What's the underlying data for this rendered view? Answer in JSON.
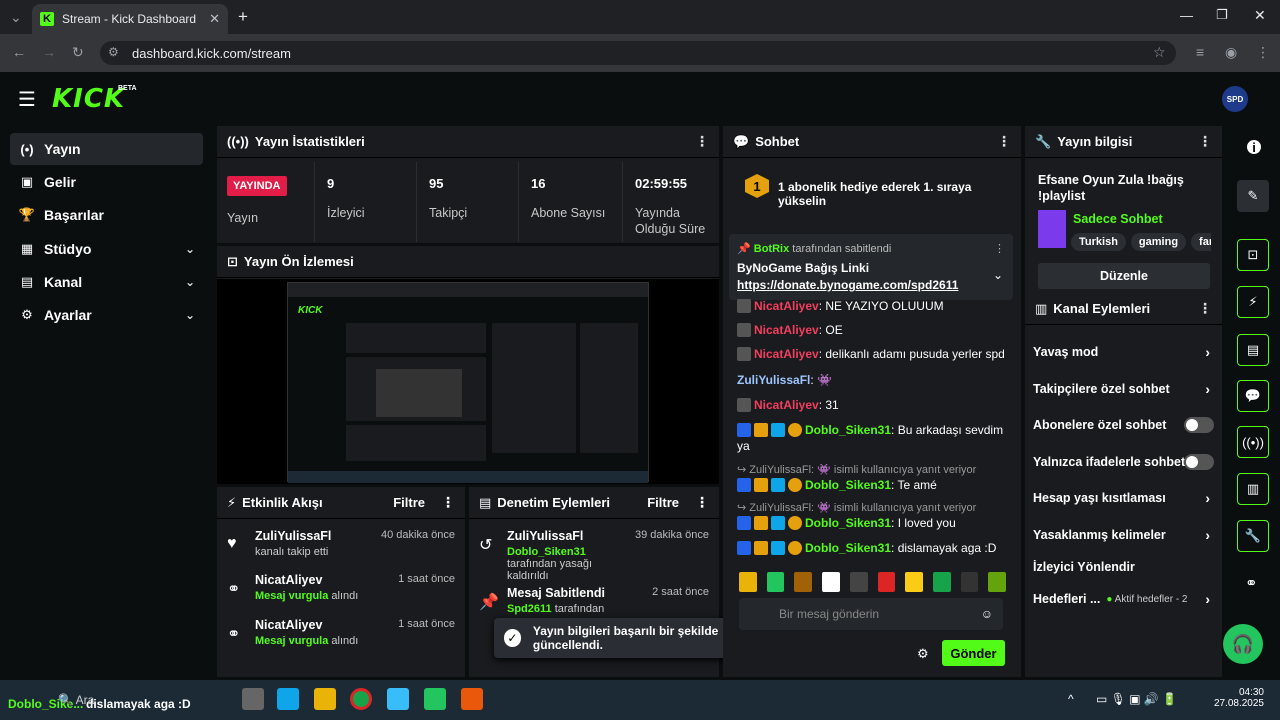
{
  "browser": {
    "tab_title": "Stream - Kick Dashboard",
    "url": "dashboard.kick.com/stream"
  },
  "logo": {
    "text": "KICK",
    "beta": "BETA"
  },
  "sidebar": {
    "items": [
      {
        "label": "Yayın",
        "icon": "broadcast-icon"
      },
      {
        "label": "Gelir",
        "icon": "chart-icon"
      },
      {
        "label": "Başarılar",
        "icon": "trophy-icon"
      },
      {
        "label": "Stüdyo",
        "icon": "studio-icon"
      },
      {
        "label": "Kanal",
        "icon": "people-icon"
      },
      {
        "label": "Ayarlar",
        "icon": "gear-icon"
      }
    ]
  },
  "stats": {
    "title": "Yayın İstatistikleri",
    "live": "YAYINDA",
    "live_label": "Yayın",
    "viewers": "9",
    "viewers_label": "İzleyici",
    "followers": "95",
    "followers_label": "Takipçi",
    "subs": "16",
    "subs_label": "Abone Sayısı",
    "uptime": "02:59:55",
    "uptime_label": "Yayında Olduğu Süre"
  },
  "preview": {
    "title": "Yayın Ön İzlemesi"
  },
  "activity": {
    "title": "Etkinlik Akışı",
    "filter": "Filtre",
    "rows": [
      {
        "name": "ZuliYulissaFl",
        "sub": "kanalı takip etti",
        "time": "40 dakika önce"
      },
      {
        "name": "NicatAliyev",
        "sub_hl": "Mesaj vurgula",
        "sub": " alındı",
        "time": "1 saat önce"
      },
      {
        "name": "NicatAliyev",
        "sub_hl": "Mesaj vurgula",
        "sub": " alındı",
        "time": "1 saat önce"
      }
    ]
  },
  "moderation": {
    "title": "Denetim Eylemleri",
    "filter": "Filtre",
    "rows": [
      {
        "name": "ZuliYulissaFl",
        "sub_hl": "Doblo_Siken31",
        "sub": " tarafından yasağı kaldırıldı",
        "time": "39 dakika önce"
      },
      {
        "name": "Mesaj Sabitlendi",
        "sub_hl": "Spd2611",
        "sub": " tarafından",
        "time": "2 saat önce"
      }
    ]
  },
  "toast": {
    "text": "Yayın bilgileri başarılı bir şekilde güncellendi."
  },
  "chat": {
    "title": "Sohbet",
    "goal_num": "1",
    "goal": "1 abonelik hediye ederek 1. sıraya yükselin",
    "pinned_by": "BotRix",
    "pinned_suffix": " tarafından sabitlendi",
    "pinned_title": "ByNoGame Bağış Linki",
    "pinned_link": "https://donate.bynogame.com/spd2611",
    "messages": [
      {
        "user": "NicatAliyev",
        "text": "NE YAZIYO OLUUUM"
      },
      {
        "user": "NicatAliyev",
        "text": "OE"
      },
      {
        "user": "NicatAliyev",
        "text": "delikanlı adamı pusuda yerler spd"
      },
      {
        "user": "ZuliYulissaFl",
        "text": ""
      },
      {
        "user": "NicatAliyev",
        "text": "31"
      },
      {
        "user": "Doblo_Siken31",
        "text": "Bu arkadaşı sevdim ya"
      },
      {
        "reply": "ZuliYulissaFl:",
        "reply_note": "isimli kullanıcıya yanıt veriyor",
        "user": "Doblo_Siken31",
        "text": "Te amé"
      },
      {
        "reply": "ZuliYulissaFl:",
        "reply_note": "isimli kullanıcıya yanıt veriyor",
        "user": "Doblo_Siken31",
        "text": "I loved you"
      },
      {
        "user": "Doblo_Siken31",
        "text": "dislamayak aga :D"
      }
    ],
    "input_placeholder": "Bir mesaj gönderin",
    "send": "Gönder"
  },
  "streaminfo": {
    "title": "Yayın bilgisi",
    "stream_title": "Efsane Oyun Zula !bağış !playlist",
    "category": "Sadece Sohbet",
    "tags": [
      "Turkish",
      "gaming",
      "fam"
    ],
    "edit": "Düzenle"
  },
  "channel_actions": {
    "title": "Kanal Eylemleri",
    "items": [
      {
        "label": "Yavaş mod",
        "kind": "chev"
      },
      {
        "label": "Takipçilere özel sohbet",
        "kind": "chev"
      },
      {
        "label": "Abonelere özel sohbet",
        "kind": "toggle"
      },
      {
        "label": "Yalnızca ifadelerle sohbet",
        "kind": "toggle"
      },
      {
        "label": "Hesap yaşı kısıtlaması",
        "kind": "chev"
      },
      {
        "label": "Yasaklanmış kelimeler",
        "kind": "chev"
      },
      {
        "label": "İzleyici Yönlendir",
        "kind": "none"
      },
      {
        "label": "Hedefleri ...",
        "kind": "chev",
        "extra": "Aktif hedefler - 2"
      }
    ]
  },
  "taskbar": {
    "ticker": "dislamayak aga :D",
    "ticker_user": "Doblo_Sike...",
    "search": "Ara",
    "time": "04:30",
    "date": "27.08.2025"
  }
}
